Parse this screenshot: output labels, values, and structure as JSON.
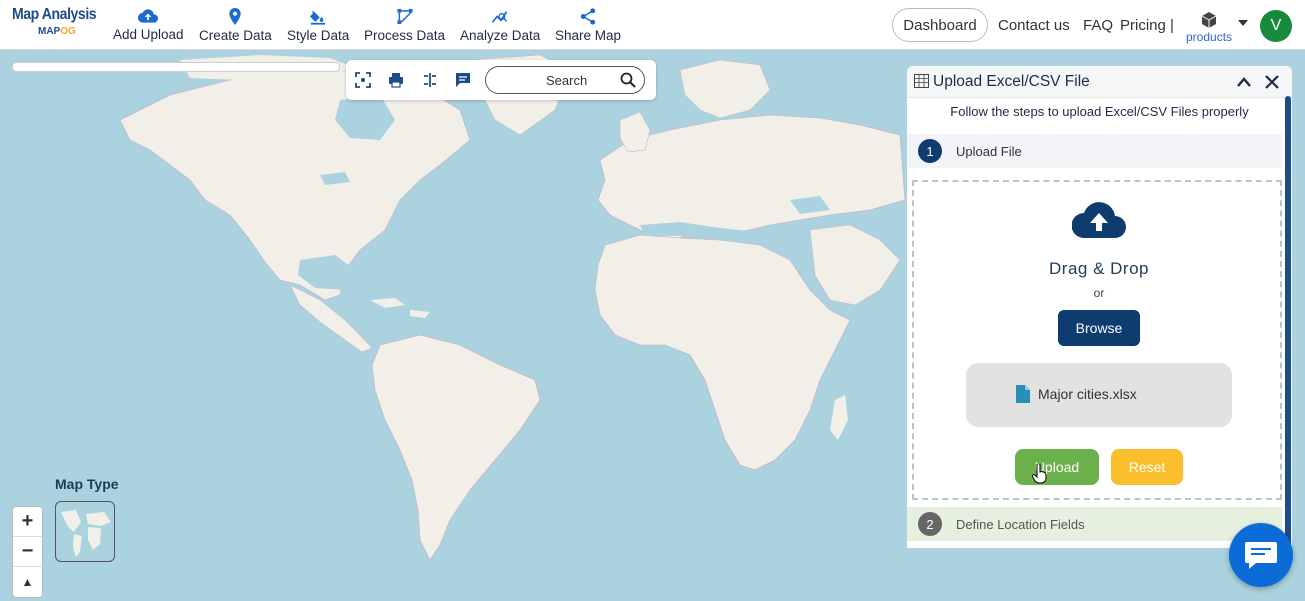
{
  "logo": {
    "title": "Map Analysis",
    "sub_left": "MAP",
    "sub_right": "OG"
  },
  "nav": [
    {
      "label": "Add Upload",
      "icon": "cloud-upload-icon"
    },
    {
      "label": "Create Data",
      "icon": "map-pin-icon"
    },
    {
      "label": "Style Data",
      "icon": "paint-bucket-icon"
    },
    {
      "label": "Process Data",
      "icon": "process-nodes-icon"
    },
    {
      "label": "Analyze Data",
      "icon": "analyze-chart-icon"
    },
    {
      "label": "Share Map",
      "icon": "share-icon"
    }
  ],
  "topright": {
    "dashboard": "Dashboard",
    "contact": "Contact us",
    "faq": "FAQ",
    "pricing": "Pricing |",
    "products": "products",
    "avatar_letter": "V"
  },
  "toolbar": {
    "search_placeholder": "Search"
  },
  "map": {
    "map_type_label": "Map Type",
    "zoom_in": "+",
    "zoom_out": "−",
    "compass": "▲"
  },
  "panel": {
    "title": "Upload Excel/CSV File",
    "subtitle": "Follow the steps to upload Excel/CSV Files properly",
    "steps": [
      {
        "num": "1",
        "label": "Upload File"
      },
      {
        "num": "2",
        "label": "Define Location Fields"
      }
    ],
    "drag_drop": "Drag & Drop",
    "or": "or",
    "browse": "Browse",
    "file_name": "Major cities.xlsx",
    "upload": "Upload",
    "reset": "Reset"
  },
  "colors": {
    "brand": "#1e4c8a",
    "ocean": "#aad3df",
    "land": "#f2efe9",
    "upload_green": "#6cb04c",
    "reset_yellow": "#fbbe2c",
    "browse_navy": "#0e3c6e",
    "avatar_green": "#178a3c"
  }
}
